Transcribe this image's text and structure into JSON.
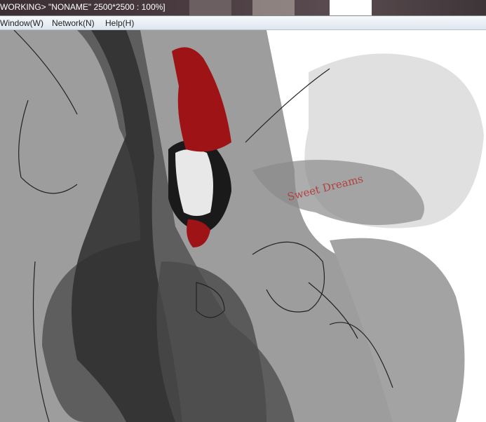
{
  "title": "WORKING>  \"NONAME\" 2500*2500 : 100%]",
  "menu": [
    "Window(W)",
    "Network(N)",
    "Help(H)"
  ],
  "canvas": {
    "artwork_text": "Sweet Dreams",
    "accent_red": "#9e1416"
  }
}
